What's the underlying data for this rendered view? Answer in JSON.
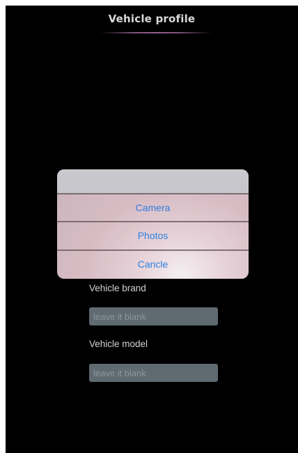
{
  "header": {
    "title": "Vehicle profile"
  },
  "action_sheet": {
    "options": [
      {
        "label": "Camera"
      },
      {
        "label": "Photos"
      },
      {
        "label": "Cancle"
      }
    ]
  },
  "form": {
    "brand_label": "Vehicle brand",
    "brand_placeholder": "leave it blank",
    "model_label": "Vehicle model",
    "model_placeholder": "leave it blank"
  },
  "colors": {
    "background": "#000000",
    "option_text": "#2f7fe0",
    "input_background": "#5f6a71",
    "accent_underline": "#a56aa0"
  }
}
